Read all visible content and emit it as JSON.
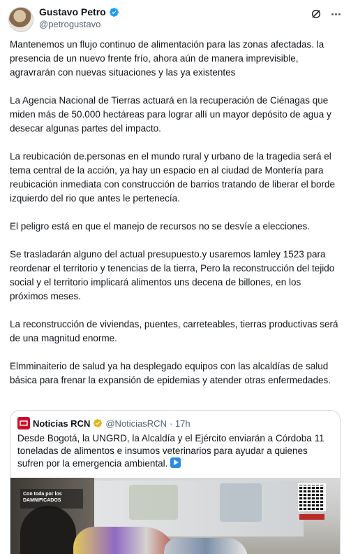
{
  "author": {
    "display_name": "Gustavo Petro",
    "handle": "@petrogustavo",
    "verified_color": "#1d9bf0"
  },
  "header_icons": [
    "grok-icon",
    "more-icon"
  ],
  "post": {
    "paragraphs": [
      "Mantenemos un flujo continuo de alimentación para las zonas afectadas. la presencia de un nuevo frente frío, ahora aún de manera imprevisible, agravrarán con nuevas situaciones y las ya existentes",
      "La  Agencia Nacional de Tierras actuará en la recuperación de Ciénagas que miden más de 50.000 hectáreas para lograr allí un mayor depósito de agua y desecar algunas partes del impacto.",
      "La reubicación de.personas en el mundo rural y urbano de la tragedia será el tema central de la acción, ya hay un espacio en al ciudad de Montería para reubicación inmediata con construcción de barrios tratando de liberar el borde izquierdo del rio que antes le pertenecía.",
      "El peligro está en que el manejo de recursos no se desvíe a elecciones.",
      "Se trasladarán alguno del actual presupuesto.y usaremos lamley 1523 para reordenar el territorio y tenencias de la tierra, Pero la reconstrucción del tejido social y el territorio implicará alimentos uns  decena de billones, en los próximos meses.",
      "La reconstrucción de viviendas, puentes, carreteables, tierras productivas será de una magnitud enorme.",
      "Elmminaiterio de salud ya ha desplegado equipos con las alcaldías de salud básica para frenar la expansión de epidemias y atender otras enfermedades."
    ]
  },
  "quote": {
    "display_name": "Noticias RCN",
    "handle": "@NoticiasRCN",
    "time": "· 17h",
    "verified_color": "#e2b719",
    "logo_color": "#c8102e",
    "text": "Desde Bogotá, la UNGRD, la Alcaldía y el Ejército enviarán a Córdoba 11 toneladas de alimentos e insumos veterinarios para ayudar a quienes sufren por la emergencia ambiental.",
    "media_banner": "Con toda por los DAMNIFICADOS"
  }
}
